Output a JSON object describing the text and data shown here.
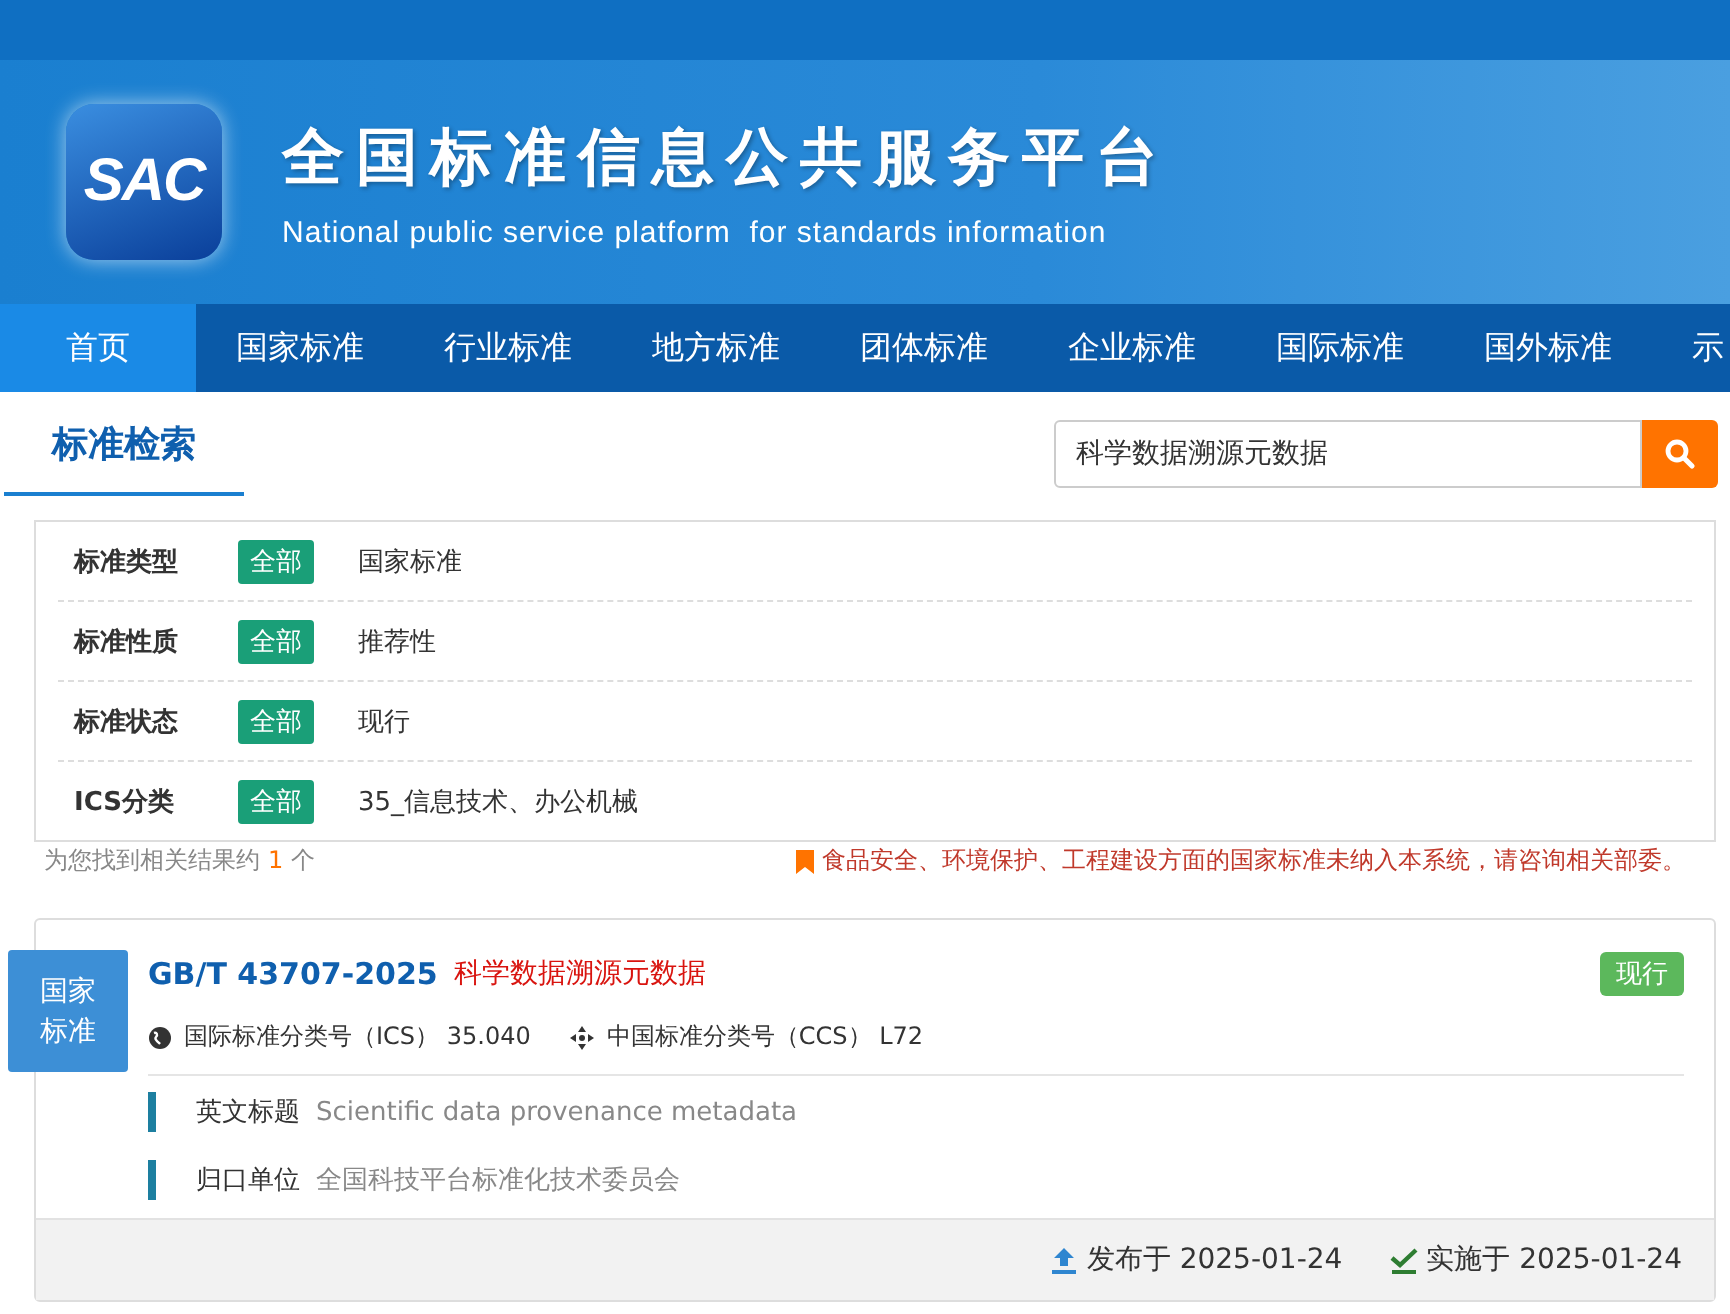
{
  "header": {
    "logo": "SAC",
    "title": "全国标准信息公共服务平台",
    "subtitle": "National public service platform  for standards information"
  },
  "nav": [
    {
      "label": "首页",
      "selected": true
    },
    {
      "label": "国家标准",
      "selected": false
    },
    {
      "label": "行业标准",
      "selected": false
    },
    {
      "label": "地方标准",
      "selected": false
    },
    {
      "label": "团体标准",
      "selected": false
    },
    {
      "label": "企业标准",
      "selected": false
    },
    {
      "label": "国际标准",
      "selected": false
    },
    {
      "label": "国外标准",
      "selected": false
    },
    {
      "label": "示",
      "selected": false
    }
  ],
  "search_tab": "标准检索",
  "search": {
    "value": "科学数据溯源元数据"
  },
  "filters": [
    {
      "label": "标准类型",
      "all": "全部",
      "all_selected": true,
      "value": "国家标准"
    },
    {
      "label": "标准性质",
      "all": "全部",
      "all_selected": true,
      "value": "推荐性"
    },
    {
      "label": "标准状态",
      "all": "全部",
      "all_selected": true,
      "value": "现行"
    },
    {
      "label": "ICS分类",
      "all": "全部",
      "all_selected": true,
      "value": "35_信息技术、办公机械"
    }
  ],
  "result_count": {
    "before": "为您找到相关结果约",
    "count": "1",
    "after": "个"
  },
  "notice": "食品安全、环境保护、工程建设方面的国家标准未纳入本系统，请咨询相关部委。",
  "results": [
    {
      "category": "国家标准",
      "code": "GB/T 43707-2025",
      "title": "科学数据溯源元数据",
      "status": "现行",
      "ics_label": "国际标准分类号（ICS）",
      "ics": "35.040",
      "ccs_label": "中国标准分类号（CCS）",
      "ccs": "L72",
      "fields": [
        {
          "label": "英文标题",
          "value": "Scientific data provenance metadata"
        },
        {
          "label": "归口单位",
          "value": "全国科技平台标准化技术委员会"
        }
      ],
      "published": "发布于 2025-01-24",
      "effective": "实施于 2025-01-24"
    }
  ]
}
